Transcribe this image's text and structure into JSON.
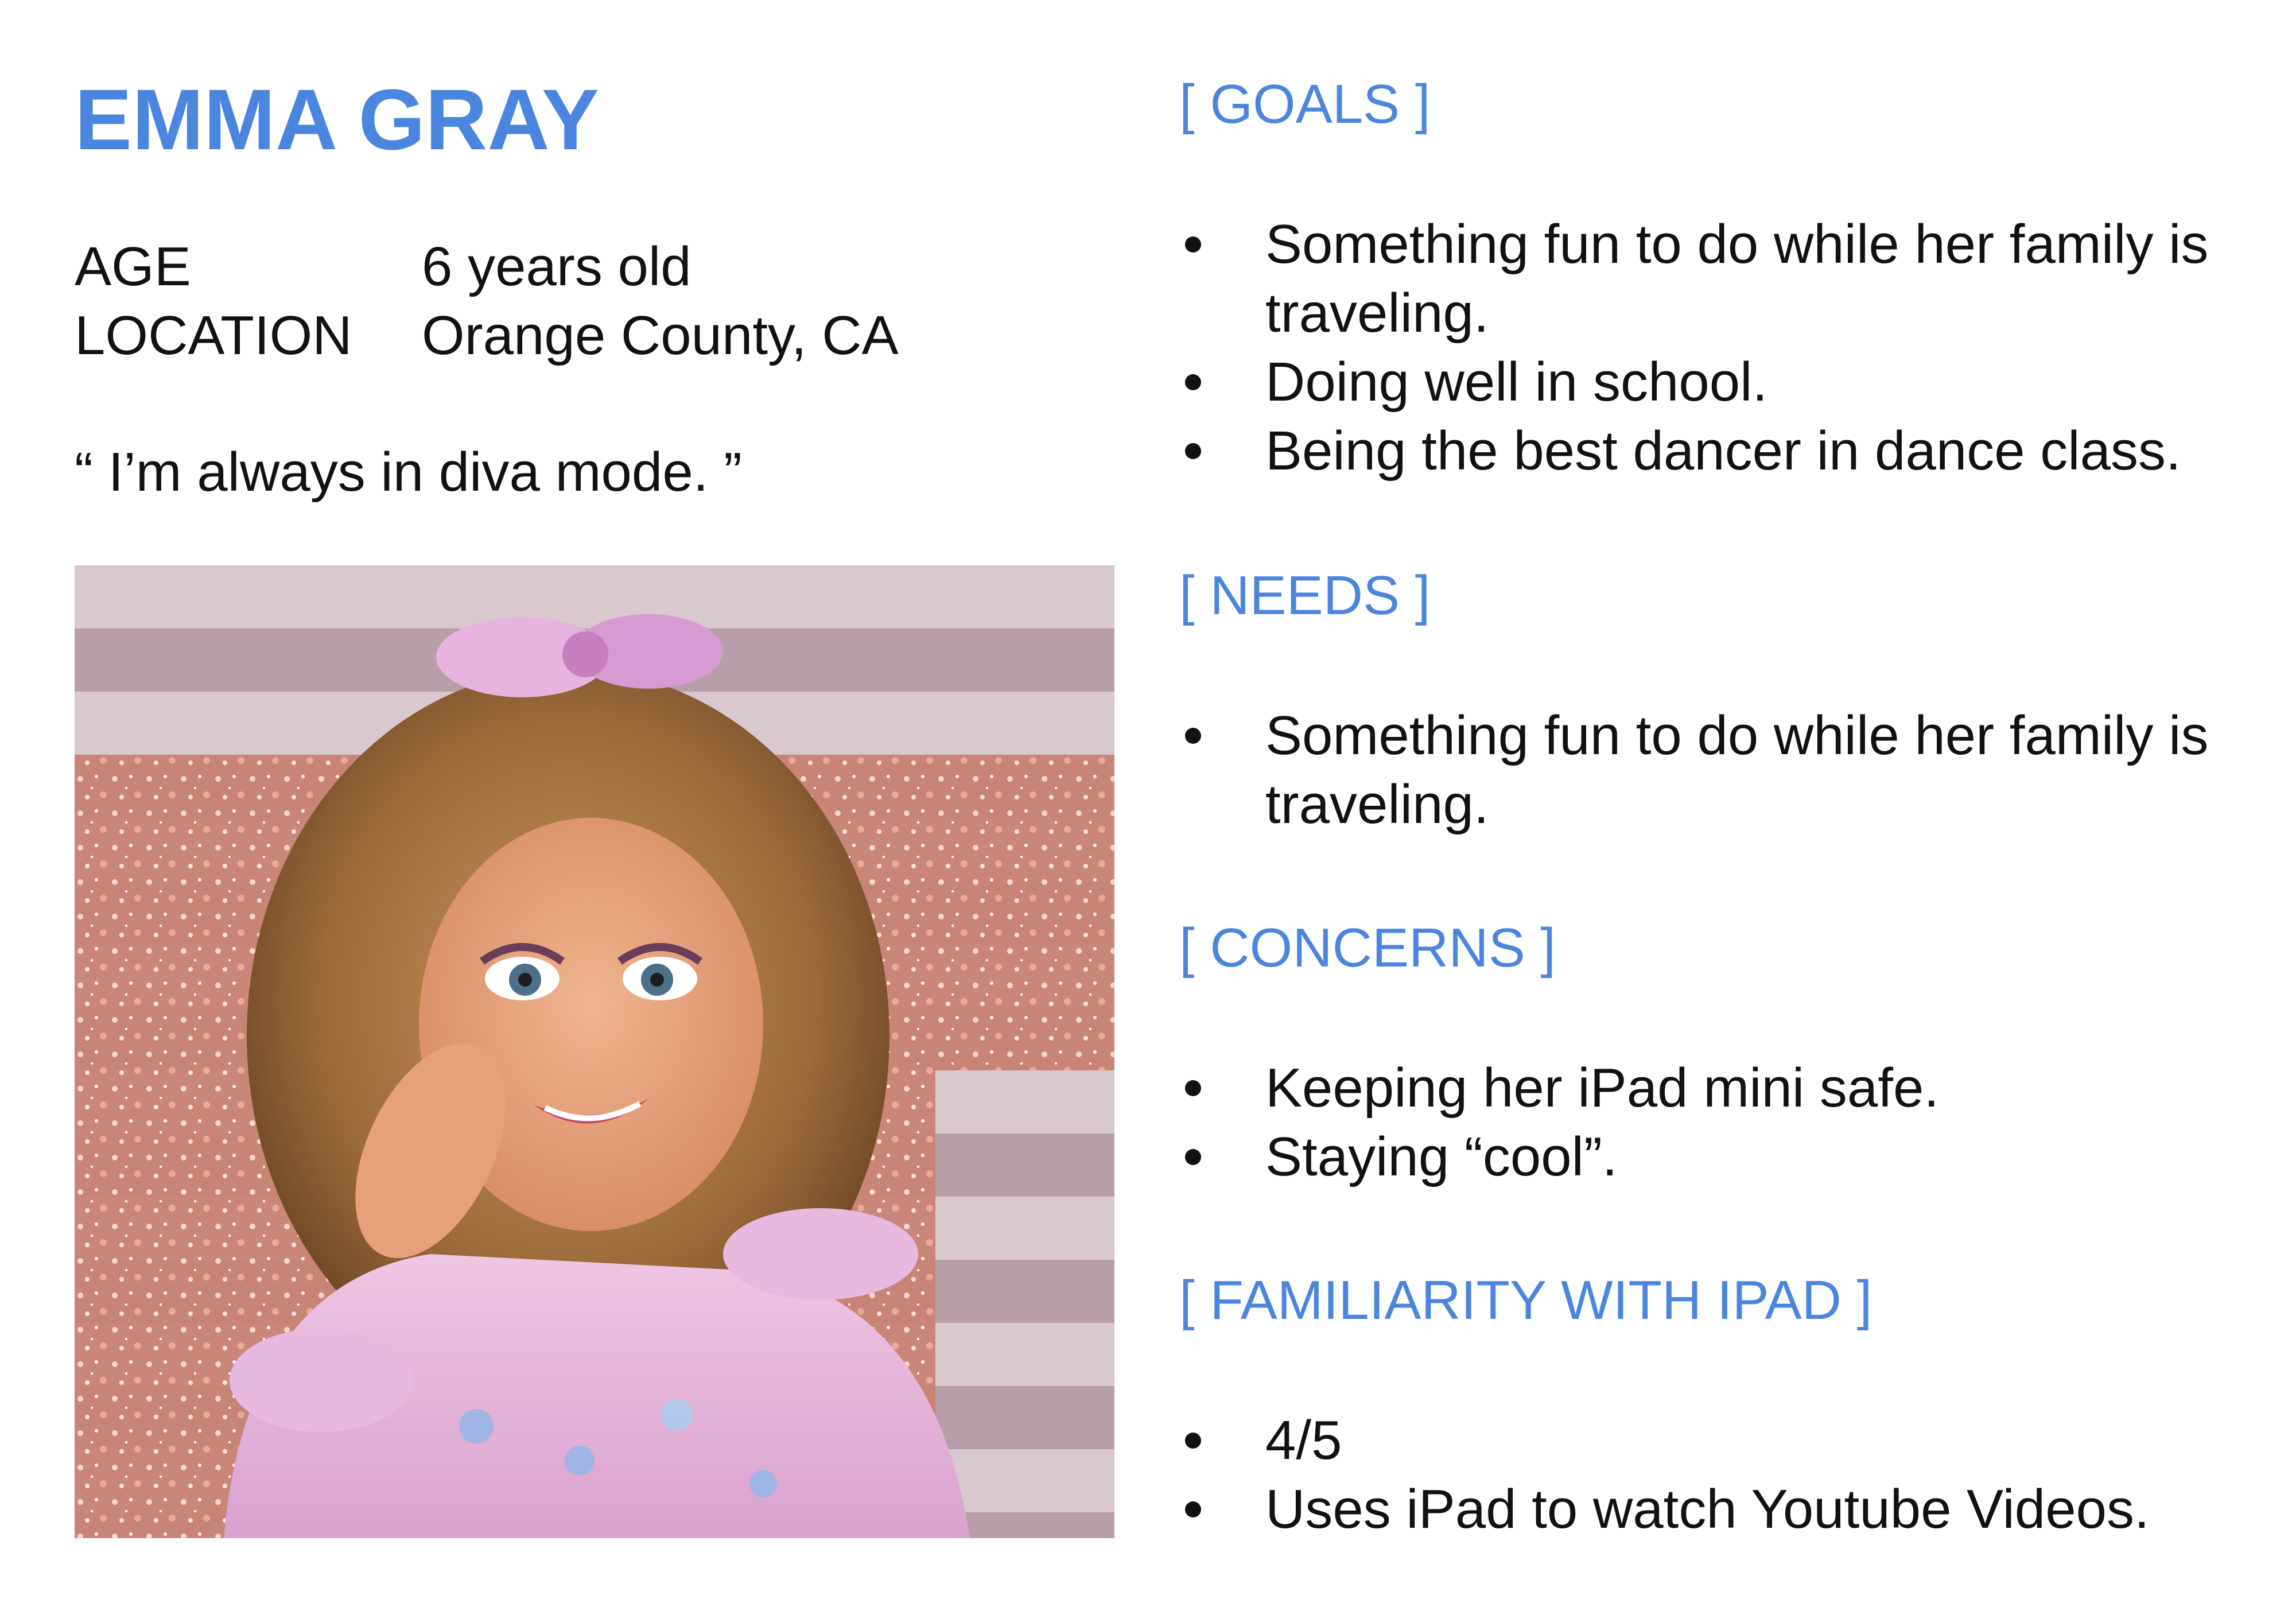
{
  "persona": {
    "name": "EMMA GRAY",
    "age_label": "AGE",
    "age_value": "6 years old",
    "location_label": "LOCATION",
    "location_value": "Orange County, CA",
    "quote": "“ I’m always in diva mode. ”"
  },
  "sections": {
    "goals": {
      "title": "[ GOALS ]",
      "items": [
        "Something fun to do while her family is traveling.",
        "Doing well in school.",
        "Being the best dancer in dance class."
      ]
    },
    "needs": {
      "title": "[ NEEDS ]",
      "items": [
        "Something fun to do while her family is traveling."
      ]
    },
    "concerns": {
      "title": "[ CONCERNS ]",
      "items": [
        "Keeping her iPad mini safe.",
        "Staying “cool”."
      ]
    },
    "familiarity": {
      "title": "[ FAMILIARITY WITH IPAD ]",
      "items": [
        "4/5",
        "Uses iPad to watch Youtube Videos."
      ]
    }
  },
  "colors": {
    "accent": "#4a86e0",
    "text": "#111111"
  }
}
